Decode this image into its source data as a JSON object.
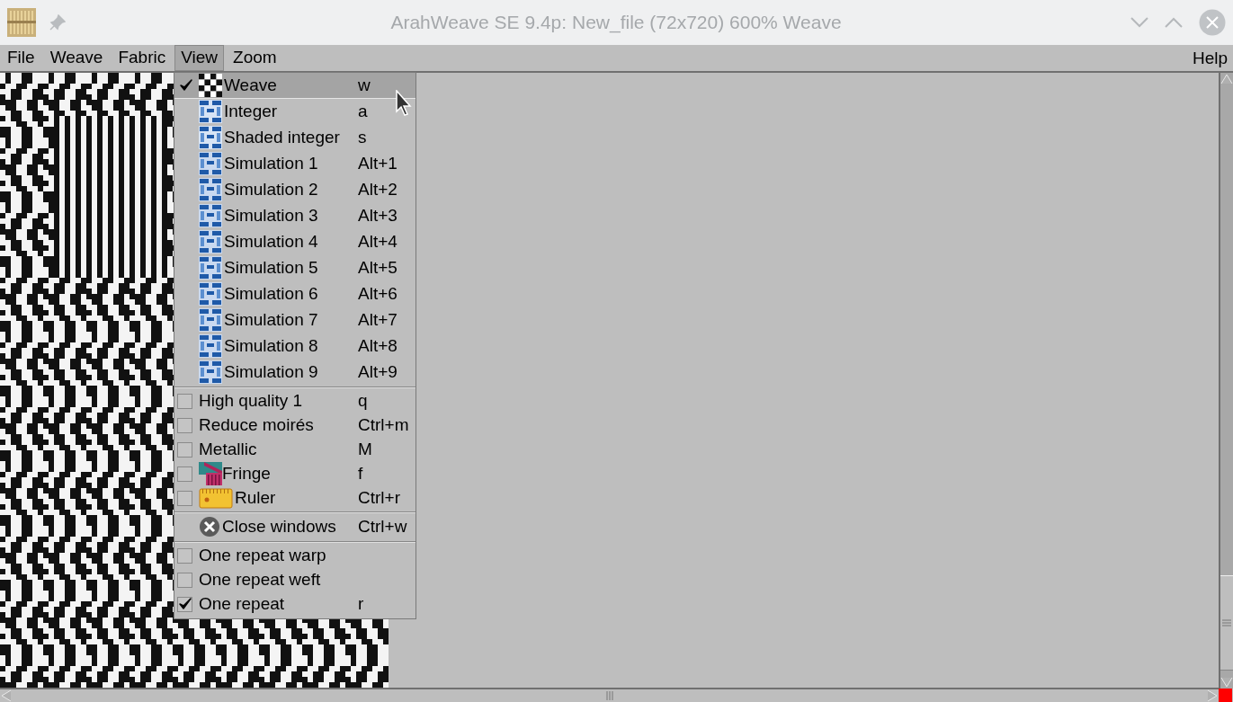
{
  "window": {
    "title": "ArahWeave SE 9.4p: New_file (72x720) 600% Weave"
  },
  "menubar": {
    "items": [
      {
        "label": "File",
        "selected": false
      },
      {
        "label": "Weave",
        "selected": false
      },
      {
        "label": "Fabric",
        "selected": false
      },
      {
        "label": "View",
        "selected": true
      },
      {
        "label": "Zoom",
        "selected": false
      }
    ],
    "help": "Help"
  },
  "menu": {
    "sections": [
      {
        "items": [
          {
            "label": "Weave",
            "shortcut": "w",
            "kind": "weave",
            "checked": true,
            "selected": true
          },
          {
            "label": "Integer",
            "shortcut": "a",
            "kind": "integer",
            "checked": false,
            "selected": false
          },
          {
            "label": "Shaded integer",
            "shortcut": "s",
            "kind": "integer",
            "checked": false,
            "selected": false
          },
          {
            "label": "Simulation 1",
            "shortcut": "Alt+1",
            "kind": "simulation",
            "checked": false,
            "selected": false
          },
          {
            "label": "Simulation 2",
            "shortcut": "Alt+2",
            "kind": "simulation",
            "checked": false,
            "selected": false
          },
          {
            "label": "Simulation 3",
            "shortcut": "Alt+3",
            "kind": "simulation",
            "checked": false,
            "selected": false
          },
          {
            "label": "Simulation 4",
            "shortcut": "Alt+4",
            "kind": "simulation",
            "checked": false,
            "selected": false
          },
          {
            "label": "Simulation 5",
            "shortcut": "Alt+5",
            "kind": "simulation",
            "checked": false,
            "selected": false
          },
          {
            "label": "Simulation 6",
            "shortcut": "Alt+6",
            "kind": "simulation",
            "checked": false,
            "selected": false
          },
          {
            "label": "Simulation 7",
            "shortcut": "Alt+7",
            "kind": "simulation",
            "checked": false,
            "selected": false
          },
          {
            "label": "Simulation 8",
            "shortcut": "Alt+8",
            "kind": "simulation",
            "checked": false,
            "selected": false
          },
          {
            "label": "Simulation 9",
            "shortcut": "Alt+9",
            "kind": "simulation",
            "checked": false,
            "selected": false
          }
        ]
      },
      {
        "items": [
          {
            "label": "High quality 1",
            "shortcut": "q",
            "kind": "check",
            "checked": false,
            "selected": false
          },
          {
            "label": "Reduce moirés",
            "shortcut": "Ctrl+m",
            "kind": "check",
            "checked": false,
            "selected": false
          },
          {
            "label": "Metallic",
            "shortcut": "M",
            "kind": "check",
            "checked": false,
            "selected": false
          },
          {
            "label": "Fringe",
            "shortcut": "f",
            "kind": "fringe",
            "checked": false,
            "selected": false
          },
          {
            "label": "Ruler",
            "shortcut": "Ctrl+r",
            "kind": "ruler",
            "checked": false,
            "selected": false
          }
        ]
      },
      {
        "items": [
          {
            "label": "Close windows",
            "shortcut": "Ctrl+w",
            "kind": "close",
            "checked": false,
            "selected": false
          }
        ]
      },
      {
        "items": [
          {
            "label": "One repeat warp",
            "kind": "check",
            "checked": false,
            "selected": false
          },
          {
            "label": "One repeat weft",
            "kind": "check",
            "checked": false,
            "selected": false
          },
          {
            "label": "One repeat",
            "shortcut": "r",
            "kind": "check",
            "checked": true,
            "selected": false
          }
        ]
      }
    ]
  }
}
